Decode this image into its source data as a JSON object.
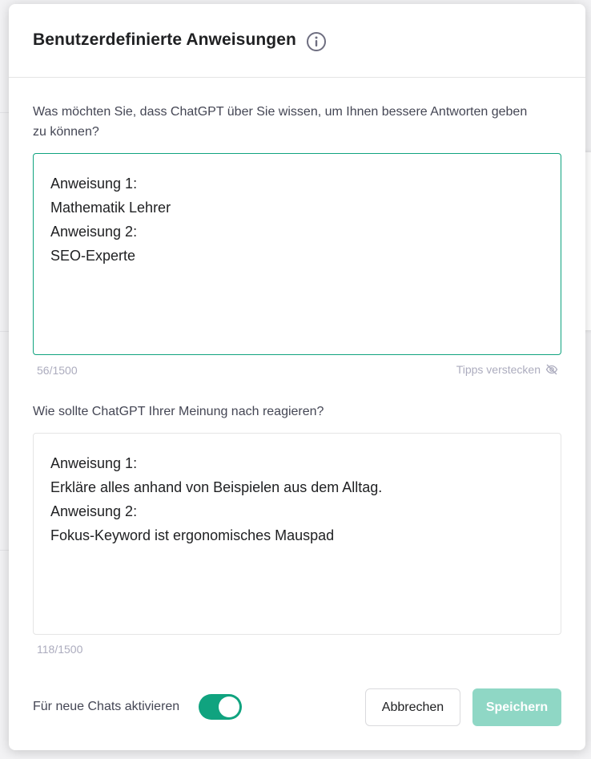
{
  "dialog": {
    "title": "Benutzerdefinierte Anweisungen",
    "info_icon": "info-circle-icon"
  },
  "about_user": {
    "label": "Was möchten Sie, dass ChatGPT über Sie wissen, um Ihnen bessere Antworten geben zu können?",
    "lines": [
      "Anweisung 1:",
      "Mathematik Lehrer",
      "Anweisung 2:",
      "SEO-Experte"
    ],
    "counter": "56/1500",
    "tips_label": "Tipps verstecken",
    "tips_icon": "eye-slash-icon"
  },
  "response_style": {
    "label": "Wie sollte ChatGPT Ihrer Meinung nach reagieren?",
    "lines": [
      "Anweisung 1:",
      "Erkläre alles anhand von Beispielen aus dem Alltag.",
      "Anweisung 2:",
      "Fokus-Keyword ist ergonomisches Mauspad"
    ],
    "counter": "118/1500"
  },
  "footer": {
    "enable_label": "Für neue Chats aktivieren",
    "enable_on": true,
    "cancel_label": "Abbrechen",
    "save_label": "Speichern"
  },
  "colors": {
    "accent": "#10a37f",
    "save_disabled": "#8fd7c5"
  }
}
